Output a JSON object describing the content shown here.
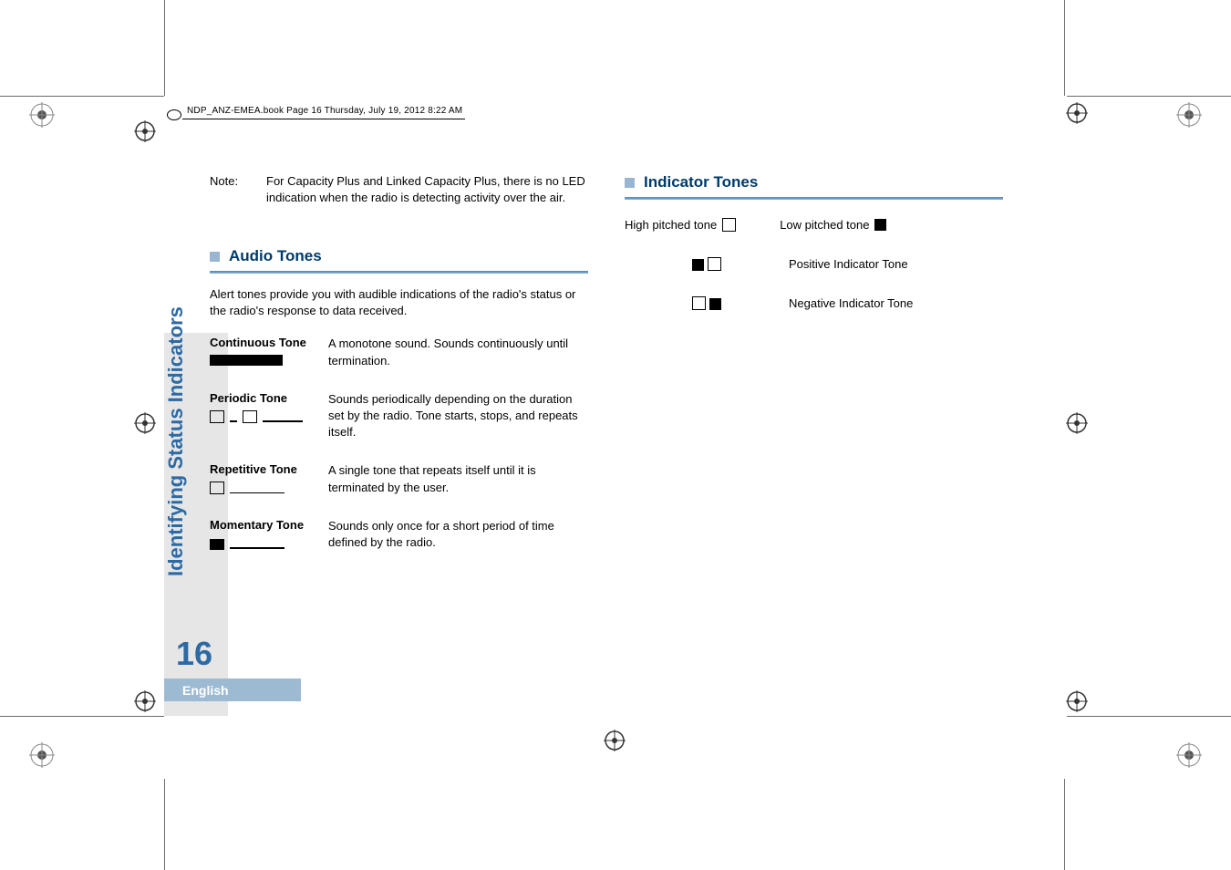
{
  "header_text": "NDP_ANZ-EMEA.book  Page 16  Thursday, July 19, 2012  8:22 AM",
  "note": {
    "label": "Note:",
    "body": "For Capacity Plus and Linked Capacity Plus, there is no LED indication when the radio is detecting activity over the air."
  },
  "audio_section": {
    "title": "Audio Tones",
    "intro": "Alert tones provide you with audible indications of the radio's status or the radio's response to data received.",
    "tones": [
      {
        "name": "Continuous Tone",
        "desc": "A monotone sound. Sounds continuously until termination."
      },
      {
        "name": "Periodic Tone",
        "desc": "Sounds periodically depending on the duration set by the radio. Tone starts, stops, and repeats itself."
      },
      {
        "name": "Repetitive Tone",
        "desc": "A single tone that repeats itself until it is terminated by the user."
      },
      {
        "name": "Momentary Tone",
        "desc": "Sounds only once for a short period of time defined by the radio."
      }
    ]
  },
  "indicator_section": {
    "title": "Indicator Tones",
    "legend": {
      "high": "High pitched tone",
      "low": "Low pitched tone"
    },
    "rows": [
      {
        "label": "Positive Indicator Tone"
      },
      {
        "label": "Negative Indicator Tone"
      }
    ]
  },
  "sidebar": {
    "title": "Identifying Status Indicators",
    "page": "16",
    "language": "English"
  }
}
